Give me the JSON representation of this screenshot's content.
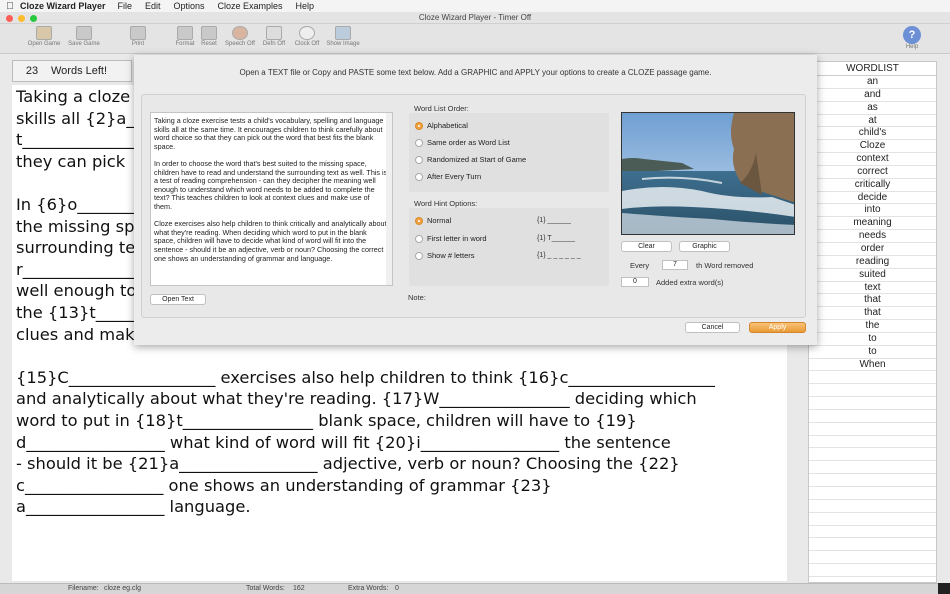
{
  "menubar": {
    "app_name": "Cloze Wizard Player",
    "items": [
      "File",
      "Edit",
      "Options",
      "Cloze Examples",
      "Help"
    ]
  },
  "window": {
    "title": "Cloze Wizard Player - Timer Off"
  },
  "toolbar": {
    "open_game": "Open Game",
    "save_game": "Save Game",
    "print": "Print",
    "format": "Format",
    "reset": "Reset",
    "speech_off": "Speech Off",
    "defn_off": "Defn Off",
    "clock_off": "Clock Off",
    "show_image": "Show Image",
    "help": "Help"
  },
  "counter": {
    "value": "23",
    "label": "Words Left!"
  },
  "passage": {
    "lines": [
      "Taking a cloze",
      "skills all {2}a_",
      "t_______________",
      "they can pick ",
      "",
      "In {6}o_________",
      "the missing sp",
      "surrounding te",
      "r_______________",
      "well enough to",
      "the {13}t_______",
      "clues and mak",
      "",
      "{15}C__________________ exercises also help children to think {16}c__________________",
      "and analytically about what they're reading. {17}W________________ deciding which",
      "word to put in {18}t________________ blank space, children will have to {19}",
      "d_________________ what kind of word will fit {20}i_________________ the sentence",
      "- should it be {21}a_________________ adjective, verb or noun? Choosing the {22}",
      "c_________________ one shows an understanding of grammar {23}",
      "a_________________ language."
    ]
  },
  "wordlist": {
    "header": "WORDLIST",
    "words": [
      "an",
      "and",
      "as",
      "at",
      "child's",
      "Cloze",
      "context",
      "correct",
      "critically",
      "decide",
      "into",
      "meaning",
      "needs",
      "order",
      "reading",
      "suited",
      "text",
      "that",
      "that",
      "the",
      "to",
      "to",
      "When"
    ]
  },
  "status": {
    "filename_label": "Filename:",
    "filename": "cloze eg.clg",
    "total_label": "Total Words:",
    "total": "162",
    "extra_label": "Extra Words:",
    "extra": "0"
  },
  "dialog": {
    "instruction": "Open a TEXT file or Copy and PASTE some text below. Add a GRAPHIC and APPLY your options to create a CLOZE passage game.",
    "text": "Taking a cloze exercise tests a child's vocabulary, spelling and language skills all at the same time. It encourages children to think carefully about word choice so that they can pick out the word that best fits the blank space.\n\nIn order to choose the word that's best suited to the missing space, children have to read and understand the surrounding text as well. This is a test of reading comprehension - can they decipher the meaning well enough to understand which word needs to be added to complete the text? This teaches children to look at context clues and make use of them.\n\nCloze exercises also help children to think critically and analytically about what they're reading. When deciding which word to put in the blank space, children will have to decide what kind of word will fit into the sentence - should it be an adjective, verb or noun? Choosing the correct one shows an understanding of grammar and language.",
    "open_text": "Open Text",
    "word_list_order_label": "Word List Order:",
    "order_options": [
      "Alphabetical",
      "Same order as Word List",
      "Randomized at Start of Game",
      "After Every Turn"
    ],
    "order_selected": "Alphabetical",
    "hint_label": "Word Hint Options:",
    "hint_options": [
      "Normal",
      "First letter in word",
      "Show # letters"
    ],
    "hint_examples": [
      "{1} ______",
      "{1} T______",
      "{1} _ _ _ _ _ _"
    ],
    "hint_selected": "Normal",
    "clear": "Clear",
    "graphic": "Graphic",
    "every_label": "Every",
    "every_value": "7",
    "every_suffix": "th Word removed",
    "extra_value": "0",
    "extra_label": "Added extra word(s)",
    "note_label": "Note:",
    "cancel": "Cancel",
    "apply": "Apply"
  },
  "colors": {
    "accent": "#f4a13d",
    "help_blue": "#6d8fd6"
  }
}
